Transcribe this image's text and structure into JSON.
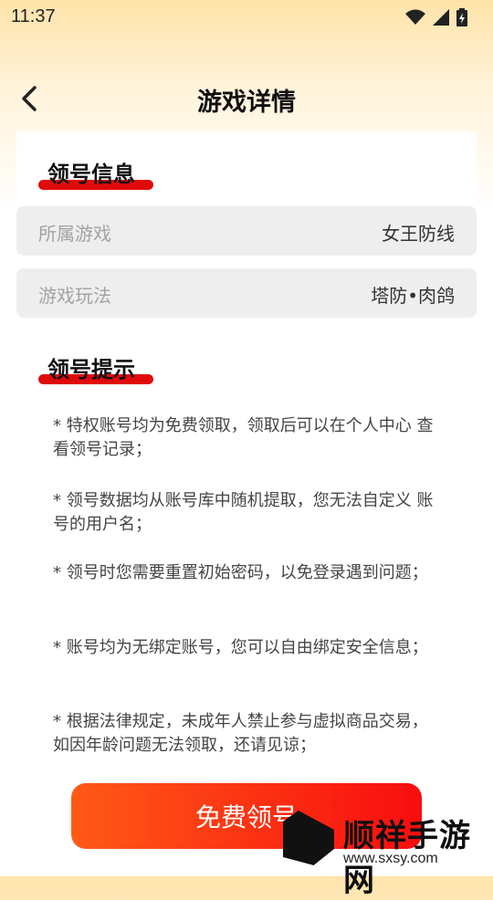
{
  "status_bar": {
    "time": "11:37",
    "icons": [
      "wifi-icon",
      "signal-icon",
      "battery-charging-icon"
    ]
  },
  "header": {
    "title": "游戏详情",
    "back_icon": "chevron-left-icon"
  },
  "account_info": {
    "title": "领号信息",
    "rows": [
      {
        "label": "所属游戏",
        "value": "女王防线"
      },
      {
        "label": "游戏玩法",
        "value": "塔防•肉鸽"
      }
    ]
  },
  "tips": {
    "title": "领号提示",
    "items": [
      "* 特权账号均为免费领取，领取后可以在个人中心 查看领号记录；",
      "*  领号数据均从账号库中随机提取，您无法自定义 账号的用户名；",
      "*  领号时您需要重置初始密码，以免登录遇到问题；",
      "*  账号均为无绑定账号，您可以自由绑定安全信息；",
      "*  根据法律规定，未成年人禁止参与虚拟商品交易， 如因年龄问题无法领取，还请见谅；"
    ]
  },
  "action": {
    "claim_label": "免费领号"
  },
  "watermark": {
    "name": "顺祥手游网",
    "url": "www.sxsy.com"
  },
  "colors": {
    "accent": "#f80d0f",
    "header_gradient": "#ffe3a9",
    "row_bg": "#eeeeee"
  }
}
